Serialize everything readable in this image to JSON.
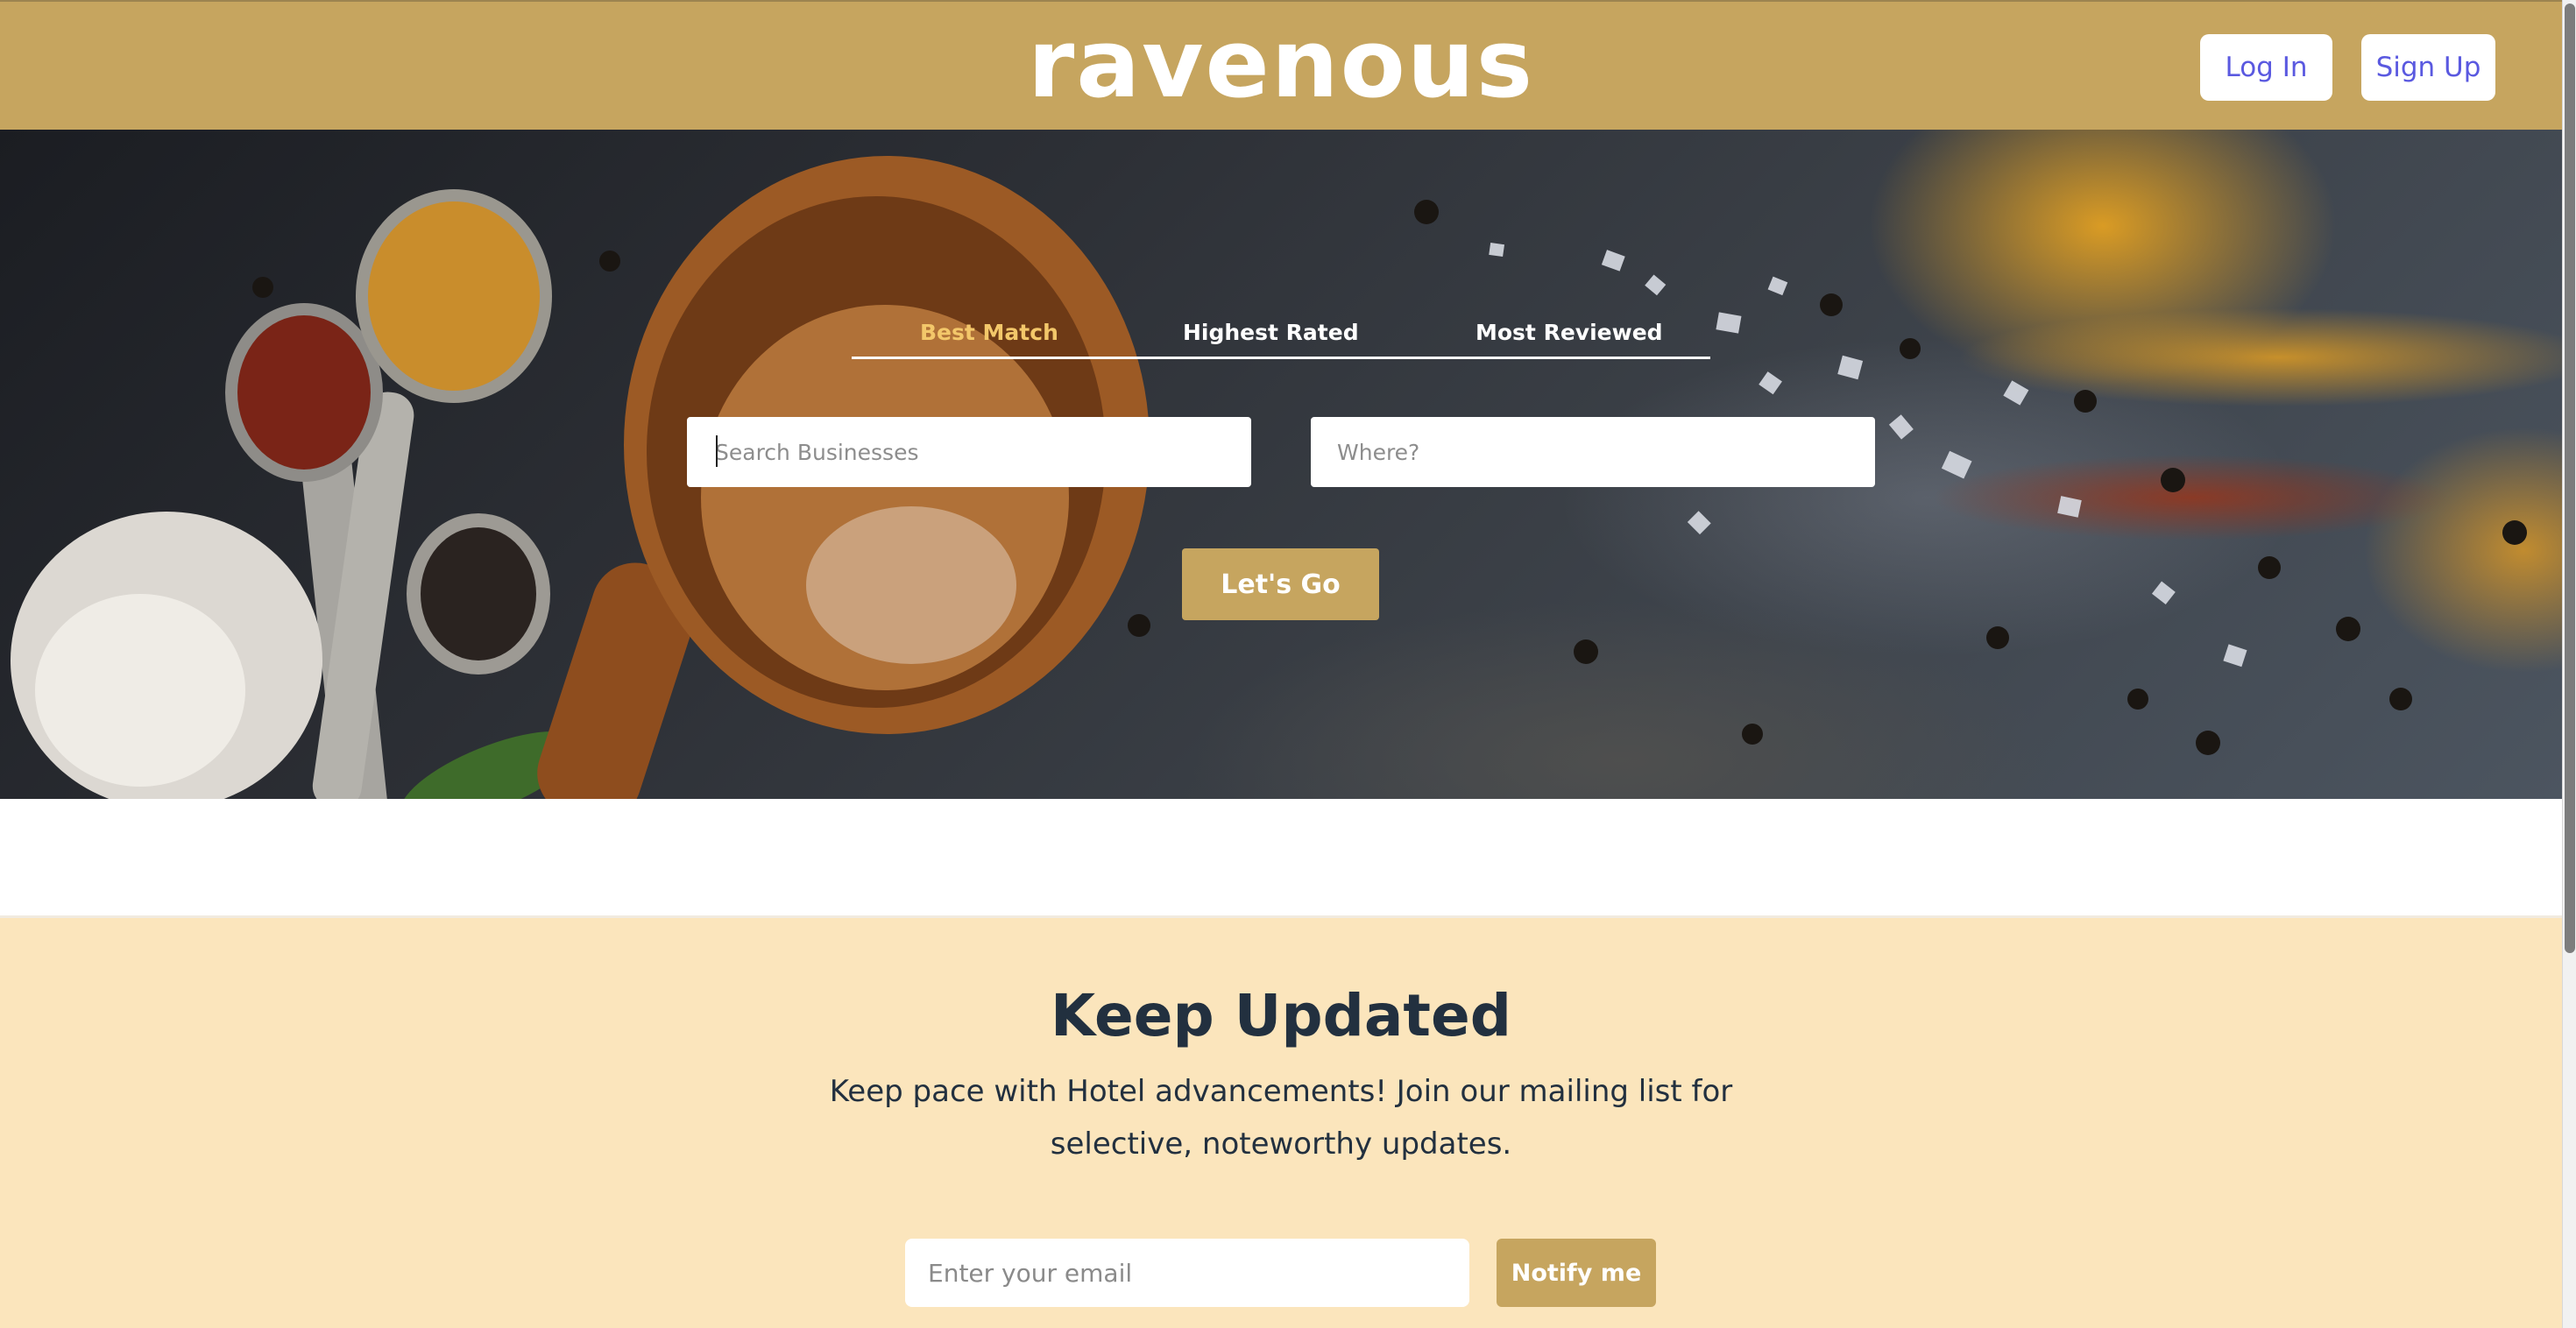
{
  "header": {
    "logo": "ravenous",
    "login_label": "Log In",
    "signup_label": "Sign Up",
    "background_color": "#c6a55f",
    "auth_text_color": "#5a59e0"
  },
  "search": {
    "sort_tabs": [
      {
        "label": "Best Match",
        "active": true
      },
      {
        "label": "Highest Rated",
        "active": false
      },
      {
        "label": "Most Reviewed",
        "active": false
      }
    ],
    "business_placeholder": "Search Businesses",
    "location_placeholder": "Where?",
    "submit_label": "Let's Go",
    "active_tab_color": "#f3c76a"
  },
  "newsletter": {
    "title": "Keep Updated",
    "text": "Keep pace with Hotel advancements! Join our mailing list for selective, noteworthy updates.",
    "email_placeholder": "Enter your email",
    "submit_label": "Notify me",
    "background_color": "#fbe5bc"
  }
}
